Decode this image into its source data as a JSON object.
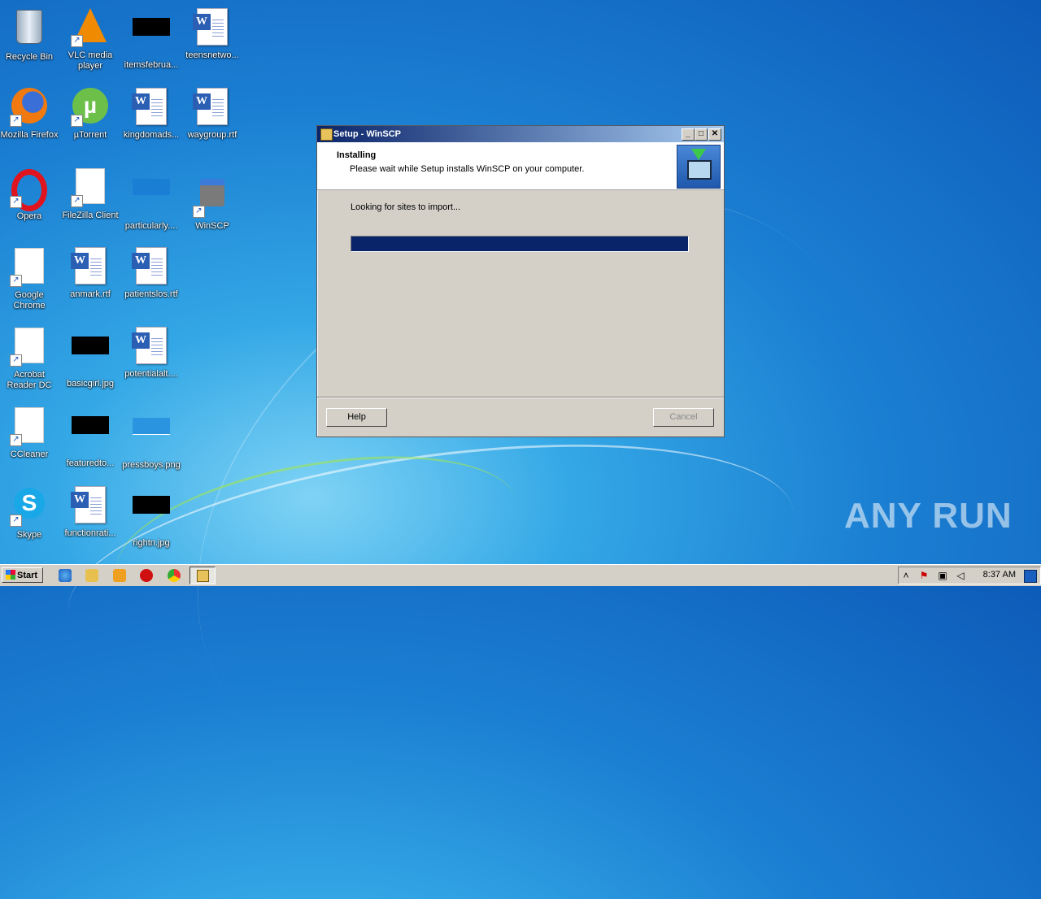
{
  "desktop": {
    "icons": [
      {
        "label": "Recycle Bin",
        "icon": "recycle-bin-icon"
      },
      {
        "label": "VLC media player",
        "icon": "vlc-icon"
      },
      {
        "label": "itemsfebrua...",
        "icon": "image-file-icon"
      },
      {
        "label": "teensnetwo...",
        "icon": "word-document-icon"
      },
      {
        "label": "Mozilla Firefox",
        "icon": "firefox-icon"
      },
      {
        "label": "µTorrent",
        "icon": "utorrent-icon"
      },
      {
        "label": "kingdomads...",
        "icon": "word-document-icon"
      },
      {
        "label": "waygroup.rtf",
        "icon": "word-document-icon"
      },
      {
        "label": "Opera",
        "icon": "opera-icon"
      },
      {
        "label": "FileZilla Client",
        "icon": "filezilla-icon"
      },
      {
        "label": "particularly....",
        "icon": "image-file-icon"
      },
      {
        "label": "WinSCP",
        "icon": "winscp-icon"
      },
      {
        "label": "Google Chrome",
        "icon": "chrome-icon"
      },
      {
        "label": "anmark.rtf",
        "icon": "word-document-icon"
      },
      {
        "label": "patientslos.rtf",
        "icon": "word-document-icon"
      },
      {
        "label": "Acrobat Reader DC",
        "icon": "acrobat-icon"
      },
      {
        "label": "basicgirl.jpg",
        "icon": "image-file-icon"
      },
      {
        "label": "potentialalt....",
        "icon": "word-document-icon"
      },
      {
        "label": "CCleaner",
        "icon": "ccleaner-icon"
      },
      {
        "label": "featuredto...",
        "icon": "image-file-icon"
      },
      {
        "label": "pressboys.png",
        "icon": "image-file-icon"
      },
      {
        "label": "Skype",
        "icon": "skype-icon"
      },
      {
        "label": "functionrati...",
        "icon": "word-document-icon"
      },
      {
        "label": "rightn.jpg",
        "icon": "image-file-icon"
      }
    ]
  },
  "dialog": {
    "title": "Setup - WinSCP",
    "heading": "Installing",
    "subheading": "Please wait while Setup installs WinSCP on your computer.",
    "status": "Looking for sites to import...",
    "progress_percent": 100,
    "help_label": "Help",
    "cancel_label": "Cancel",
    "minimize_glyph": "_",
    "maximize_glyph": "□",
    "close_glyph": "✕"
  },
  "taskbar": {
    "start_label": "Start",
    "clock": "8:37 AM"
  },
  "watermark": "ANY RUN"
}
